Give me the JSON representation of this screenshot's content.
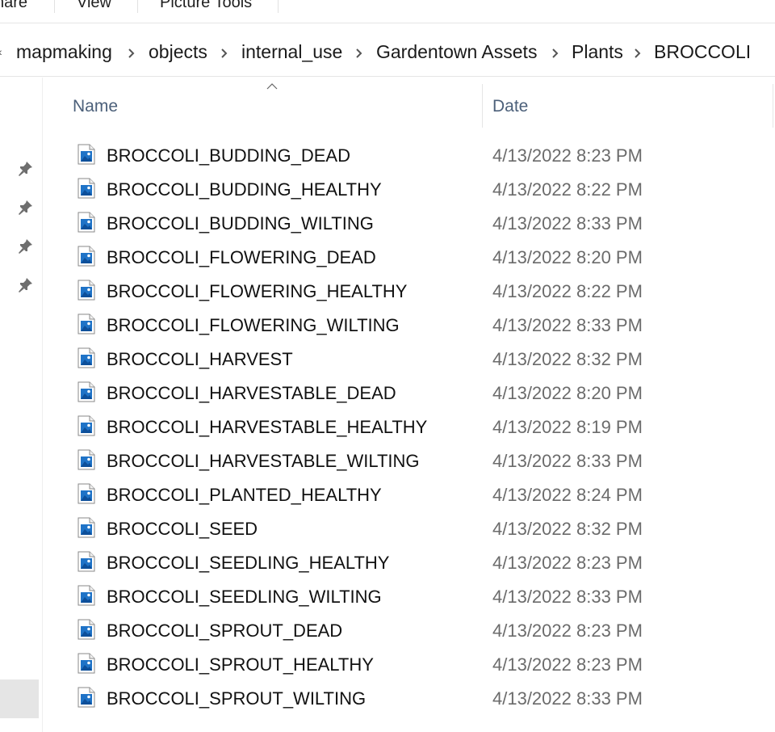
{
  "ribbon": {
    "tabs": [
      "hare",
      "View",
      "Picture Tools"
    ]
  },
  "breadcrumb": {
    "leading_glyph": "‹",
    "items": [
      "mapmaking",
      "objects",
      "internal_use",
      "Gardentown Assets",
      "Plants",
      "BROCCOLI"
    ]
  },
  "columns": {
    "name": "Name",
    "date": "Date"
  },
  "files": [
    {
      "name": "BROCCOLI_BUDDING_DEAD",
      "date": "4/13/2022 8:23 PM"
    },
    {
      "name": "BROCCOLI_BUDDING_HEALTHY",
      "date": "4/13/2022 8:22 PM"
    },
    {
      "name": "BROCCOLI_BUDDING_WILTING",
      "date": "4/13/2022 8:33 PM"
    },
    {
      "name": "BROCCOLI_FLOWERING_DEAD",
      "date": "4/13/2022 8:20 PM"
    },
    {
      "name": "BROCCOLI_FLOWERING_HEALTHY",
      "date": "4/13/2022 8:22 PM"
    },
    {
      "name": "BROCCOLI_FLOWERING_WILTING",
      "date": "4/13/2022 8:33 PM"
    },
    {
      "name": "BROCCOLI_HARVEST",
      "date": "4/13/2022 8:32 PM"
    },
    {
      "name": "BROCCOLI_HARVESTABLE_DEAD",
      "date": "4/13/2022 8:20 PM"
    },
    {
      "name": "BROCCOLI_HARVESTABLE_HEALTHY",
      "date": "4/13/2022 8:19 PM"
    },
    {
      "name": "BROCCOLI_HARVESTABLE_WILTING",
      "date": "4/13/2022 8:33 PM"
    },
    {
      "name": "BROCCOLI_PLANTED_HEALTHY",
      "date": "4/13/2022 8:24 PM"
    },
    {
      "name": "BROCCOLI_SEED",
      "date": "4/13/2022 8:32 PM"
    },
    {
      "name": "BROCCOLI_SEEDLING_HEALTHY",
      "date": "4/13/2022 8:23 PM"
    },
    {
      "name": "BROCCOLI_SEEDLING_WILTING",
      "date": "4/13/2022 8:33 PM"
    },
    {
      "name": "BROCCOLI_SPROUT_DEAD",
      "date": "4/13/2022 8:23 PM"
    },
    {
      "name": "BROCCOLI_SPROUT_HEALTHY",
      "date": "4/13/2022 8:23 PM"
    },
    {
      "name": "BROCCOLI_SPROUT_WILTING",
      "date": "4/13/2022 8:33 PM"
    }
  ],
  "icons": {
    "file": "image-file-icon",
    "pin": "pin-icon",
    "separator": "chevron-right-icon",
    "sort": "sort-ascending-icon"
  },
  "colors": {
    "header_text": "#4c607a",
    "date_text": "#6b6b6b",
    "icon_blue": "#1f73c7"
  }
}
